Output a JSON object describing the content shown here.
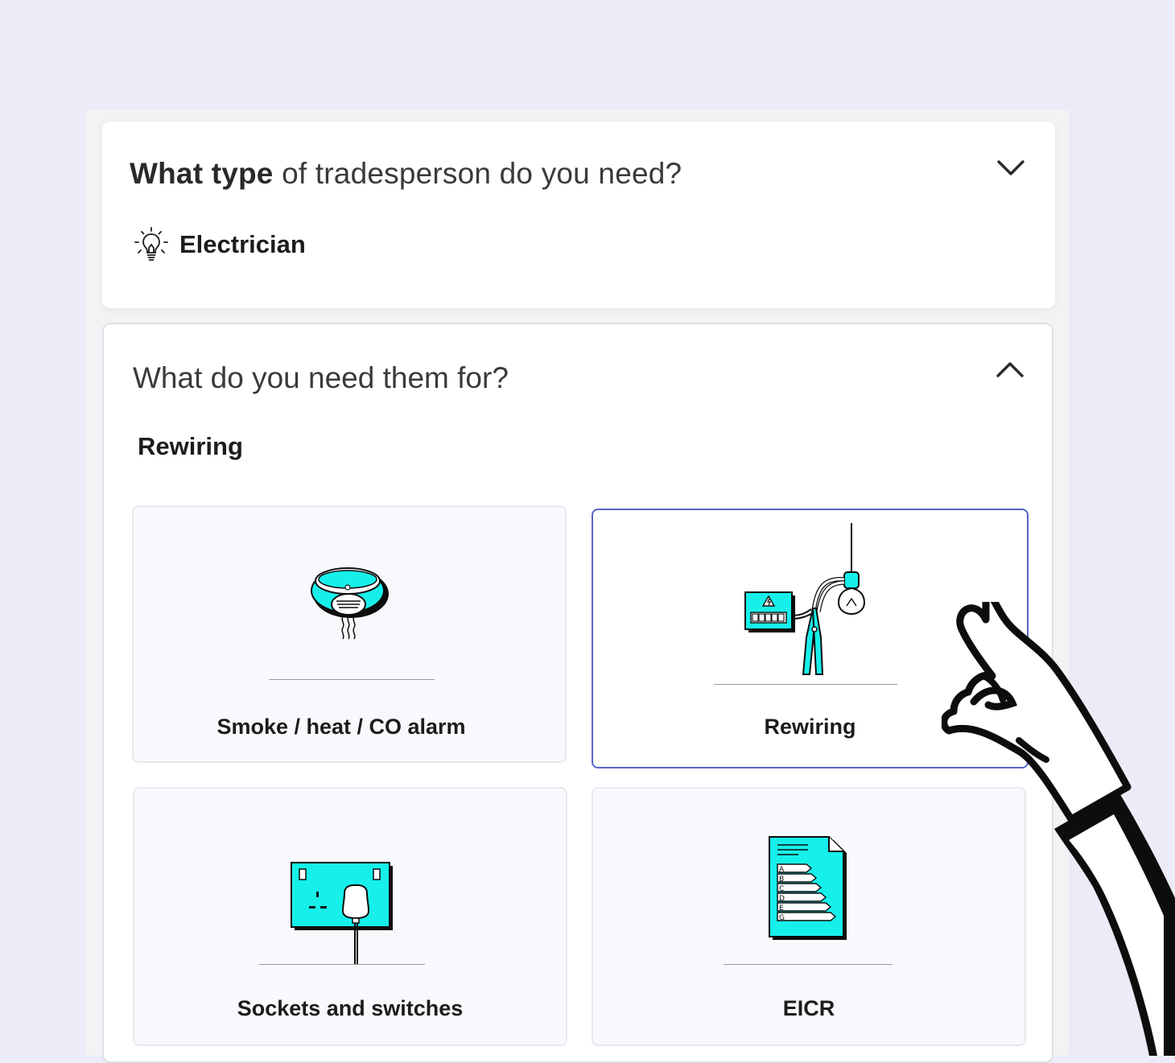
{
  "question_type": {
    "bold": "What type",
    "rest": " of tradesperson do you need?",
    "selected": "Electrician",
    "selected_icon": "lightbulb-icon",
    "toggle_icon": "chevron-down-icon"
  },
  "question_need": {
    "title": "What do you need them for?",
    "selected": "Rewiring",
    "toggle_icon": "chevron-up-icon",
    "options": [
      {
        "label": "Smoke / heat / CO alarm",
        "icon": "smoke-alarm-icon",
        "selected": false
      },
      {
        "label": "Rewiring",
        "icon": "rewiring-icon",
        "selected": true
      },
      {
        "label": "Sockets and switches",
        "icon": "socket-icon",
        "selected": false
      },
      {
        "label": "EICR",
        "icon": "eicr-document-icon",
        "selected": false
      }
    ],
    "eicr_ratings": [
      "A",
      "B",
      "C",
      "D",
      "E",
      "G"
    ]
  },
  "colors": {
    "accent": "#17f0ea",
    "selected_border": "#5764c7",
    "background": "#ecebf7"
  }
}
